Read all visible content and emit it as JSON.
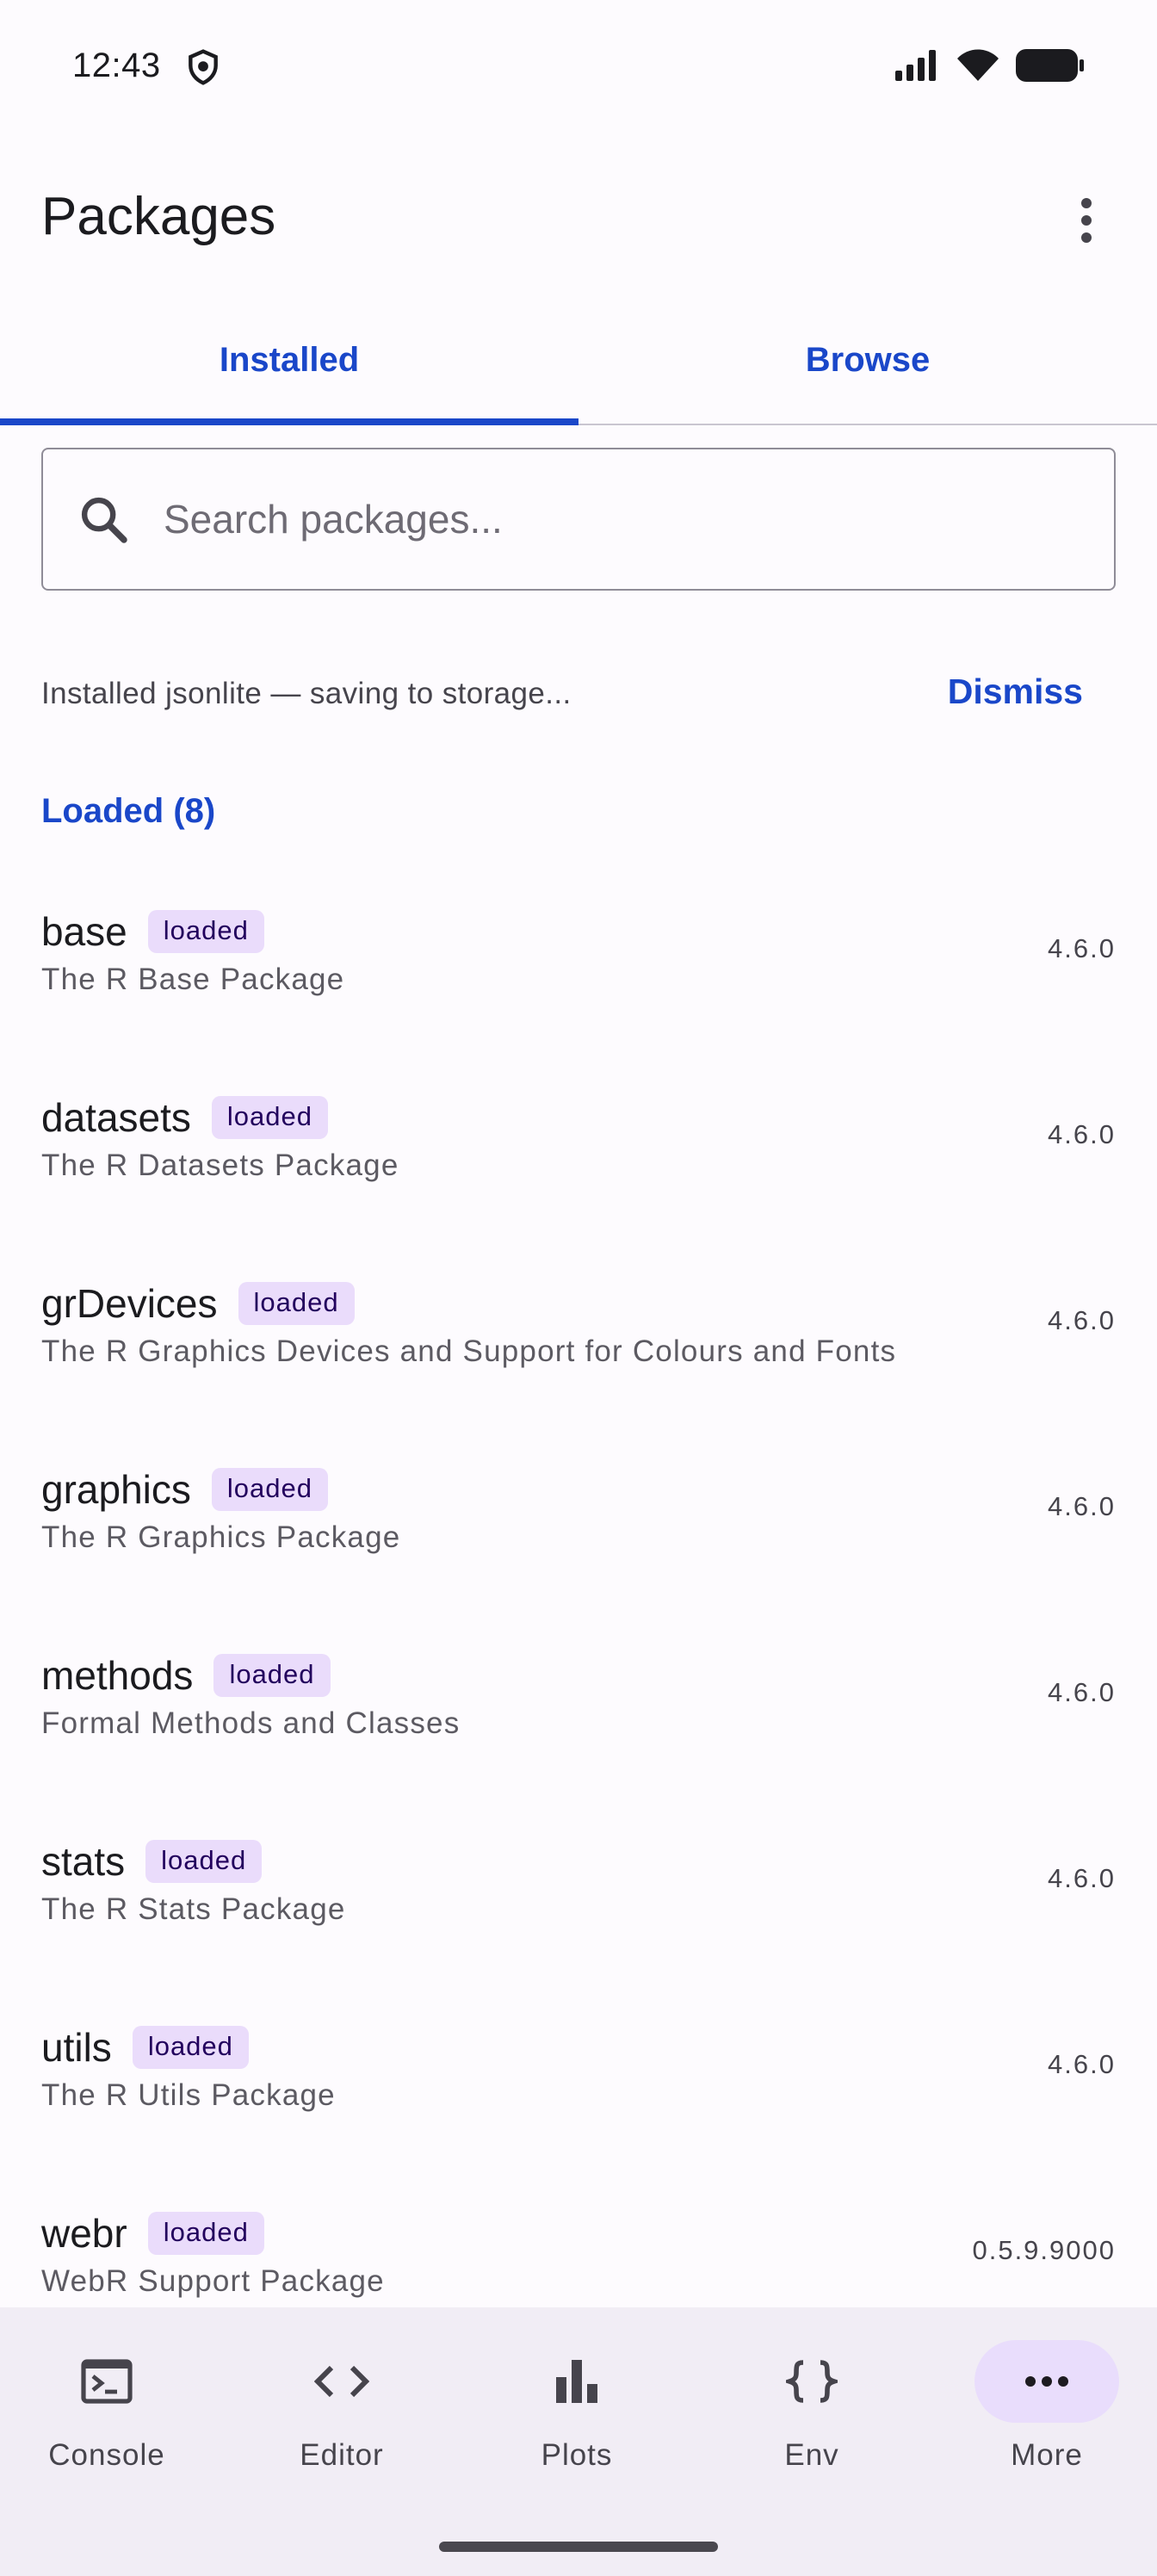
{
  "status_bar": {
    "time": "12:43"
  },
  "app_bar": {
    "title": "Packages"
  },
  "tabs": [
    {
      "label": "Installed",
      "selected": true
    },
    {
      "label": "Browse",
      "selected": false
    }
  ],
  "search": {
    "placeholder": "Search packages...",
    "value": ""
  },
  "notice": {
    "text": "Installed jsonlite — saving to storage...",
    "action": "Dismiss"
  },
  "section": {
    "header": "Loaded (8)"
  },
  "packages": [
    {
      "name": "base",
      "badge": "loaded",
      "description": "The R Base Package",
      "version": "4.6.0"
    },
    {
      "name": "datasets",
      "badge": "loaded",
      "description": "The R Datasets Package",
      "version": "4.6.0"
    },
    {
      "name": "grDevices",
      "badge": "loaded",
      "description": "The R Graphics Devices and Support for Colours and Fonts",
      "version": "4.6.0"
    },
    {
      "name": "graphics",
      "badge": "loaded",
      "description": "The R Graphics Package",
      "version": "4.6.0"
    },
    {
      "name": "methods",
      "badge": "loaded",
      "description": "Formal Methods and Classes",
      "version": "4.6.0"
    },
    {
      "name": "stats",
      "badge": "loaded",
      "description": "The R Stats Package",
      "version": "4.6.0"
    },
    {
      "name": "utils",
      "badge": "loaded",
      "description": "The R Utils Package",
      "version": "4.6.0"
    },
    {
      "name": "webr",
      "badge": "loaded",
      "description": "WebR Support Package",
      "version": "0.5.9.9000"
    }
  ],
  "bottom_nav": [
    {
      "label": "Console",
      "icon": "terminal-icon",
      "active": false
    },
    {
      "label": "Editor",
      "icon": "code-icon",
      "active": false
    },
    {
      "label": "Plots",
      "icon": "bar-chart-icon",
      "active": false
    },
    {
      "label": "Env",
      "icon": "braces-icon",
      "active": false
    },
    {
      "label": "More",
      "icon": "more-horizontal-icon",
      "active": true
    }
  ],
  "colors": {
    "accent": "#1a47c9",
    "badge_bg": "#eadcfb",
    "nav_active": "#e9ddfc",
    "nav_bg": "#f1edf5"
  }
}
